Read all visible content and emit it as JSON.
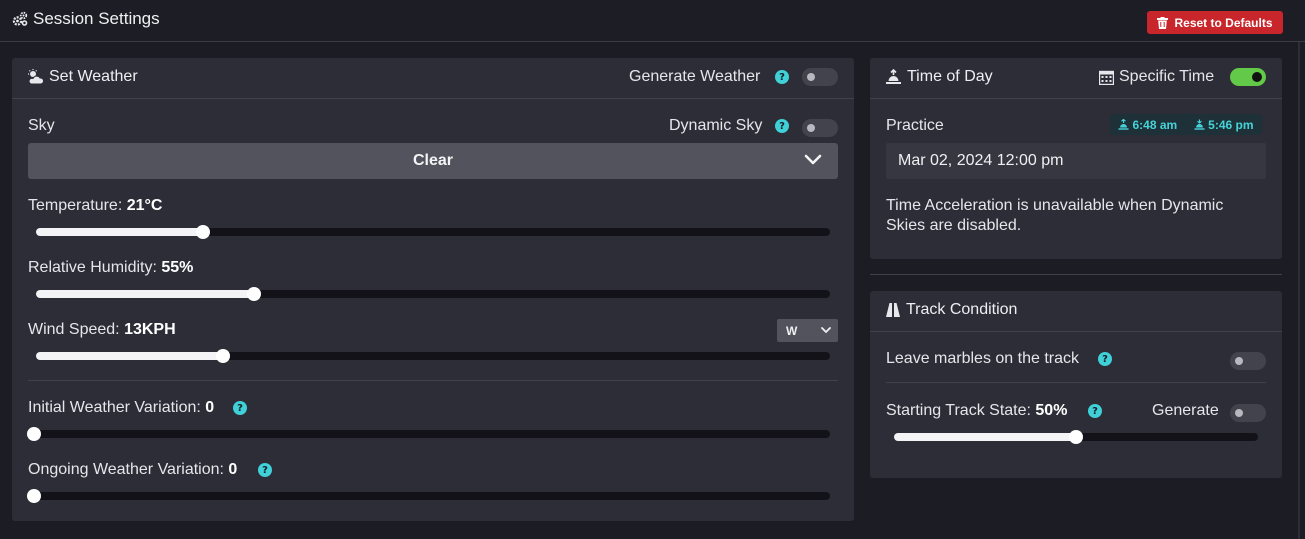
{
  "header": {
    "title": "Session Settings",
    "title_icon": "cogs-icon",
    "reset_label": "Reset to Defaults",
    "reset_icon": "trash-icon",
    "accent_color": "#c8262a"
  },
  "weather": {
    "title": "Set Weather",
    "title_icon": "cloud-sun-icon",
    "generate_label": "Generate Weather",
    "generate_on": false,
    "sky_label": "Sky",
    "dynamic_sky_label": "Dynamic Sky",
    "dynamic_sky_on": false,
    "sky_value": "Clear",
    "temperature": {
      "label": "Temperature: ",
      "value": "21°C",
      "fraction": 0.21
    },
    "humidity": {
      "label": "Relative Humidity: ",
      "value": "55%",
      "fraction": 0.274
    },
    "wind": {
      "label": "Wind Speed: ",
      "value": "13KPH",
      "fraction": 0.236,
      "direction": "W"
    },
    "initial_variation": {
      "label": "Initial Weather Variation: ",
      "value": "0",
      "fraction": 0
    },
    "ongoing_variation": {
      "label": "Ongoing Weather Variation: ",
      "value": "0",
      "fraction": 0
    }
  },
  "time": {
    "title": "Time of Day",
    "title_icon": "sunrise-icon",
    "specific_label": "Specific Time",
    "specific_icon": "calendar-icon",
    "specific_on": true,
    "session_label": "Practice",
    "sunrise": "6:48 am",
    "sunset": "5:46 pm",
    "datetime": "Mar 02, 2024 12:00 pm",
    "note": "Time Acceleration is unavailable when Dynamic Skies are disabled.",
    "toggle_on_color": "#62c949",
    "help_color": "#3fd0d8"
  },
  "track": {
    "title": "Track Condition",
    "title_icon": "road-icon",
    "marbles_label": "Leave marbles on the track",
    "marbles_on": false,
    "state_label": "Starting Track State: ",
    "state_value": "50%",
    "state_fraction": 0.5,
    "generate_label": "Generate",
    "generate_on": false
  }
}
